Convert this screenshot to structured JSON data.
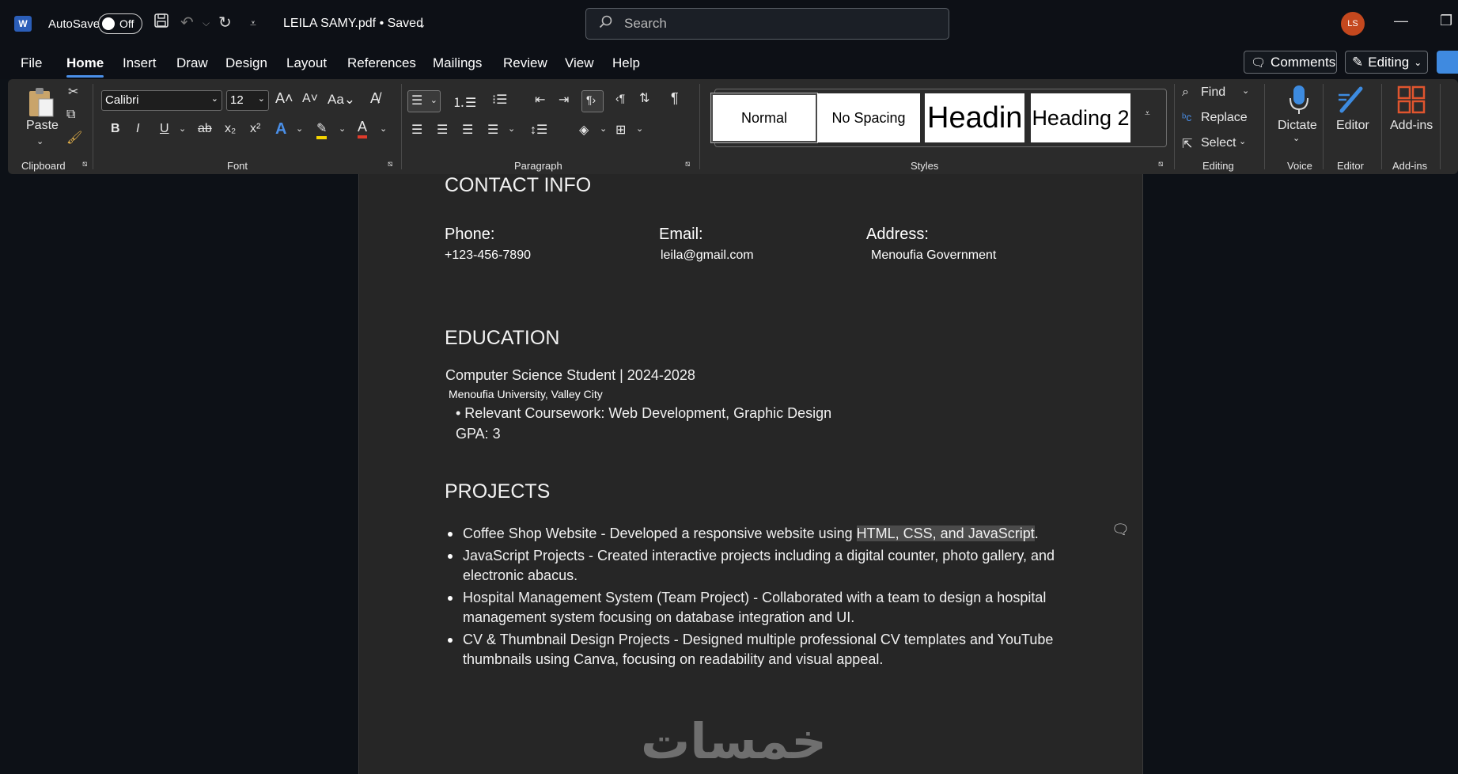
{
  "titlebar": {
    "app_logo": "W",
    "autosave_label": "AutoSave",
    "autosave_state": "Off",
    "doc_title": "LEILA SAMY.pdf • Saved",
    "search_placeholder": "Search",
    "avatar_initials": "LS",
    "minimize": "—",
    "restore": "❐"
  },
  "menu": {
    "tabs": [
      "File",
      "Home",
      "Insert",
      "Draw",
      "Design",
      "Layout",
      "References",
      "Mailings",
      "Review",
      "View",
      "Help"
    ],
    "active_tab": "Home",
    "comments_label": "Comments",
    "editing_label": "Editing"
  },
  "ribbon": {
    "clipboard": {
      "paste_label": "Paste",
      "group_label": "Clipboard"
    },
    "font": {
      "font_name": "Calibri",
      "font_size": "12",
      "group_label": "Font"
    },
    "paragraph": {
      "group_label": "Paragraph"
    },
    "styles": {
      "group_label": "Styles",
      "items": [
        "Normal",
        "No Spacing",
        "Headin",
        "Heading 2"
      ]
    },
    "editing": {
      "find": "Find",
      "replace": "Replace",
      "select": "Select",
      "group_label": "Editing"
    },
    "voice": {
      "dictate": "Dictate",
      "group_label": "Voice"
    },
    "editor": {
      "label": "Editor",
      "group_label": "Editor"
    },
    "addins": {
      "label": "Add-ins",
      "group_label": "Add-ins"
    }
  },
  "document": {
    "contact_heading": "CONTACT INFO",
    "phone_label": "Phone:",
    "phone_value": "+123-456-7890",
    "email_label": "Email:",
    "email_value": "leila@gmail.com",
    "address_label": "Address:",
    "address_value": "Menoufia Government",
    "education_heading": "EDUCATION",
    "degree": "Computer Science Student | 2024-2028",
    "university": "Menoufia University, Valley City",
    "coursework": "• Relevant Coursework: Web Development, Graphic Design",
    "gpa": "GPA: 3",
    "projects_heading": "PROJECTS",
    "p1_before": "Coffee Shop Website - Developed a responsive website using ",
    "p1_highlight": "HTML, CSS, and JavaScript",
    "p1_after": ".",
    "p2_line1": "JavaScript Projects - Created interactive projects including a digital counter, photo gallery, and",
    "p2_line2": "electronic abacus.",
    "p3_line1": "Hospital Management System (Team Project) - Collaborated with a team to design a hospital",
    "p3_line2": "management system focusing on database integration and UI.",
    "p4_line1": "CV & Thumbnail Design Projects - Designed multiple professional CV templates and YouTube",
    "p4_line2": "thumbnails using Canva, focusing on readability and visual appeal.",
    "watermark": "خمسات"
  },
  "colors": {
    "accent": "#4a8fe8",
    "avatar": "#c4481e",
    "page_bg": "#262626",
    "ribbon_bg": "#2b2b2b"
  }
}
